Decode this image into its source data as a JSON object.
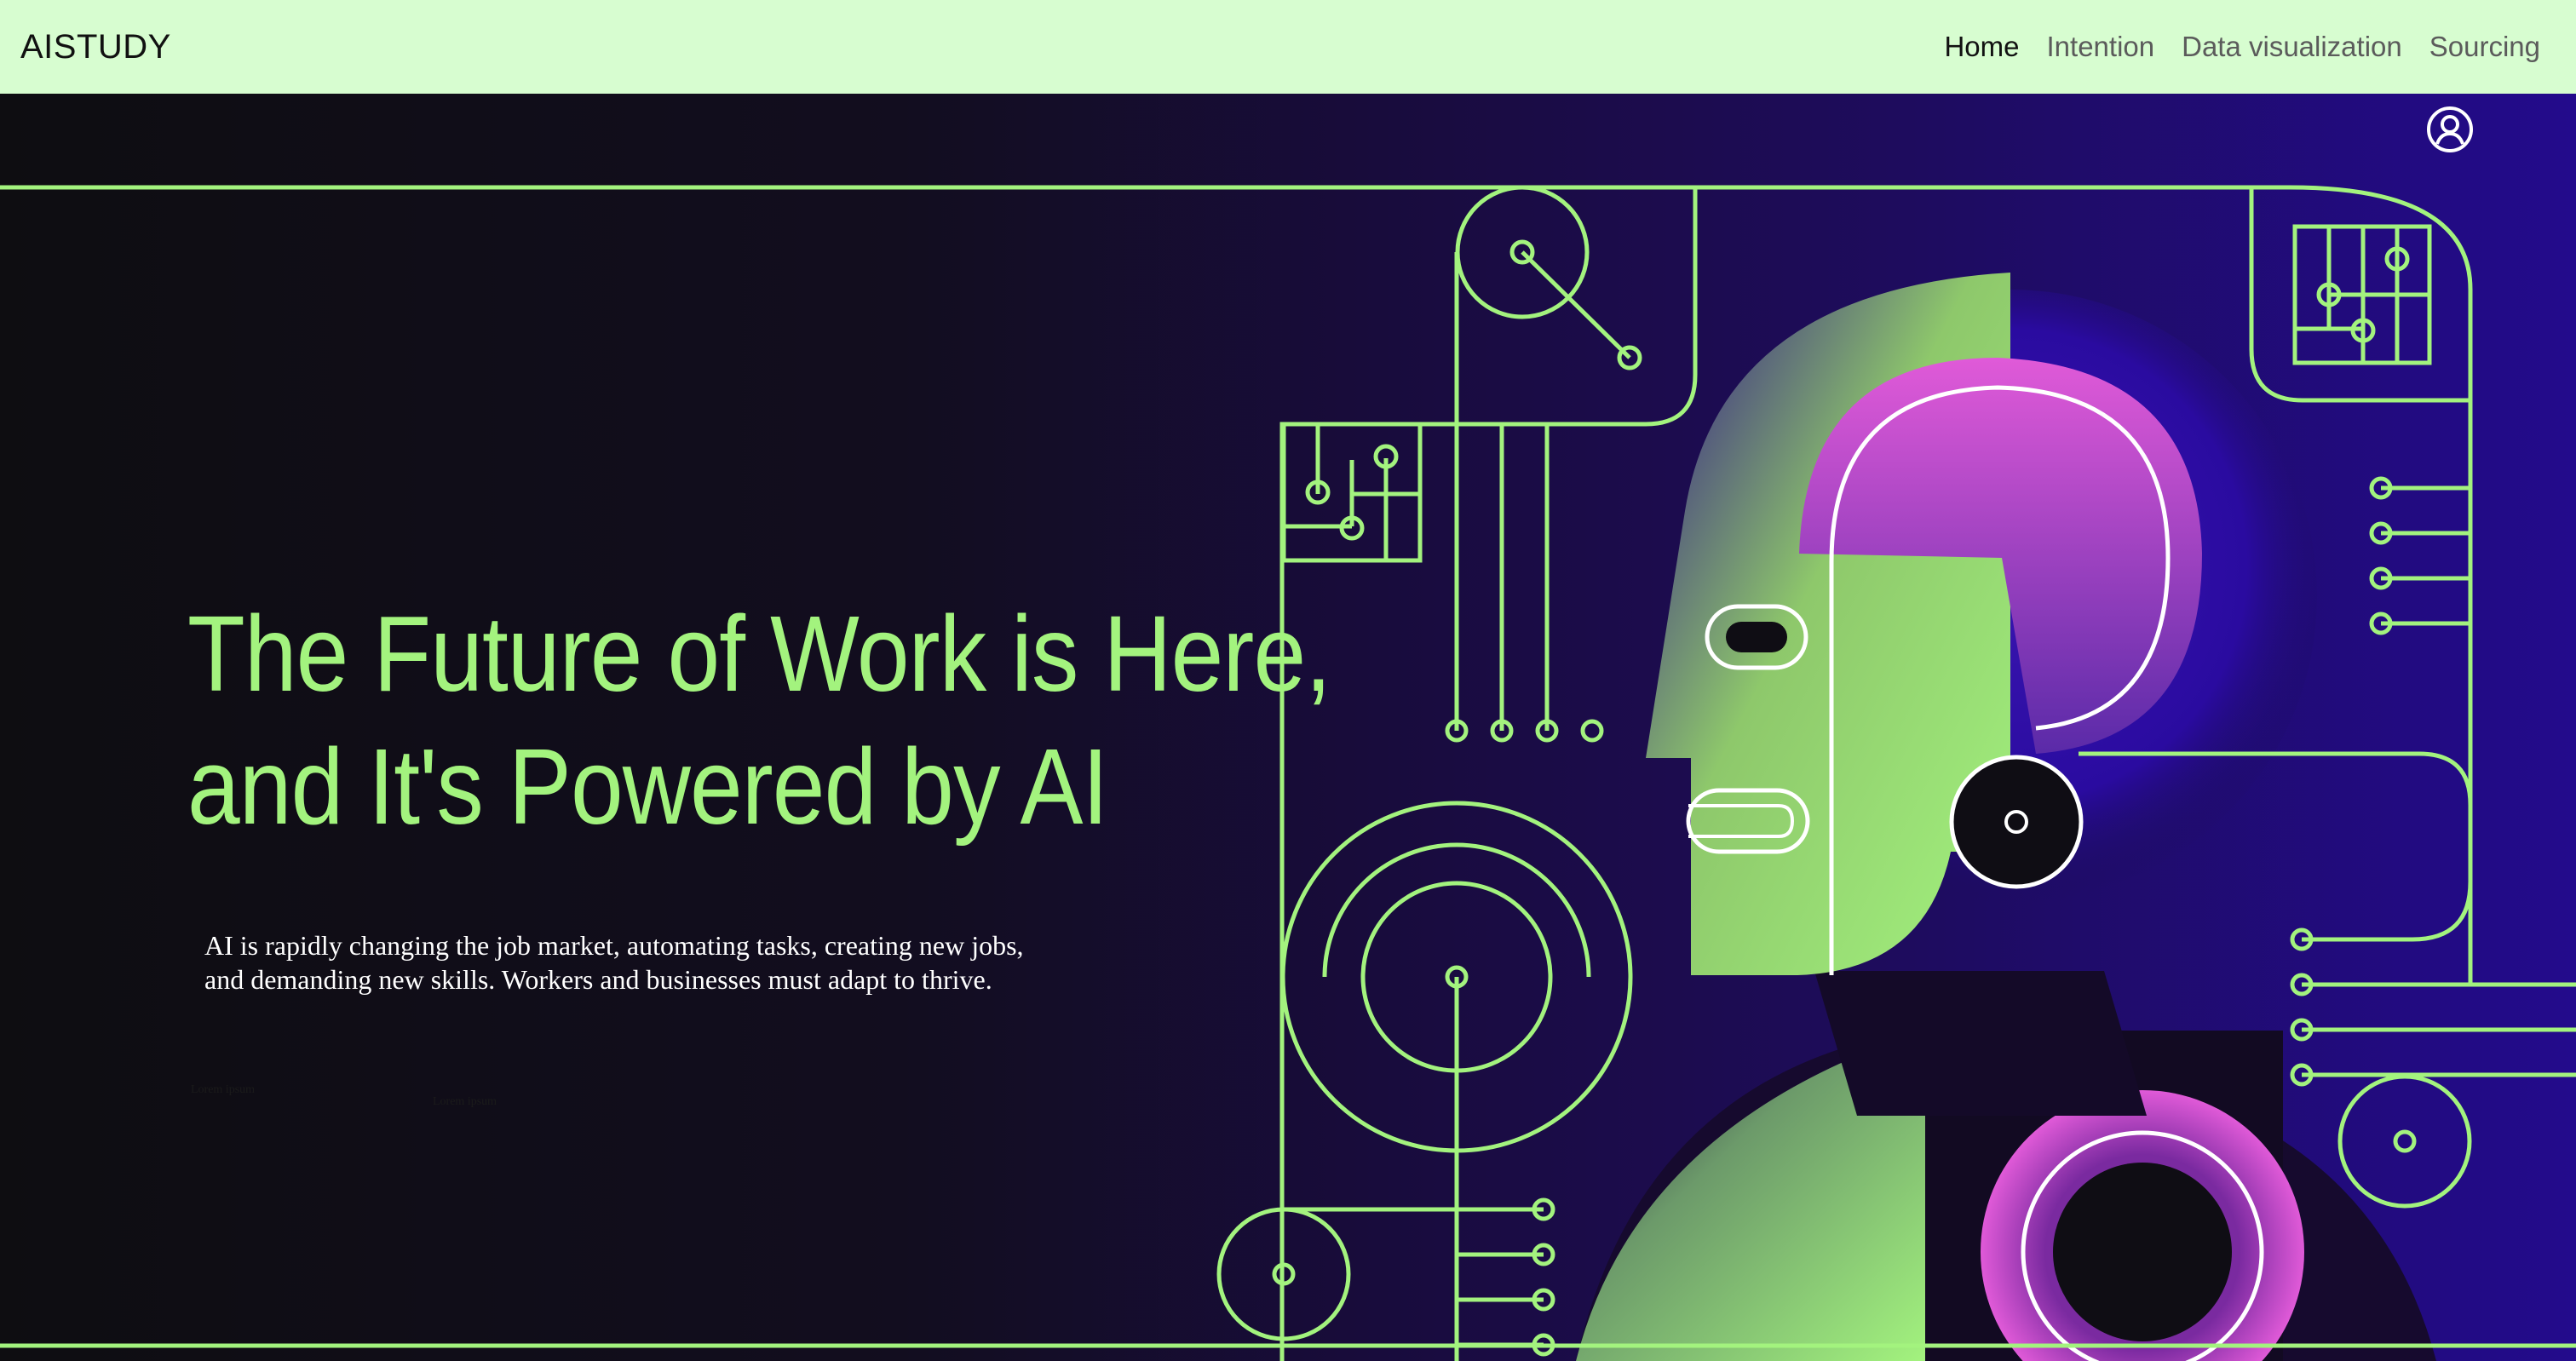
{
  "navbar": {
    "brand": "AISTUDY",
    "links": [
      {
        "label": "Home",
        "active": true
      },
      {
        "label": "Intention",
        "active": false
      },
      {
        "label": "Data visualization",
        "active": false
      },
      {
        "label": "Sourcing",
        "active": false
      }
    ],
    "background": "#d7fdd0"
  },
  "hero": {
    "headline_line1": "The Future of Work is Here,",
    "headline_line2": "and It's Powered by AI",
    "description_line1": "AI is rapidly changing the job market, automating tasks, creating new jobs,",
    "description_line2": "and demanding new skills. Workers and businesses must adapt to thrive.",
    "tiny_label_1": "Lorem ipsum",
    "tiny_label_2": "Lorem ipsum",
    "user_icon": "user-circle-icon",
    "accent_color": "#a3f37e",
    "magenta_color": "#e05ad8",
    "purple_color": "#2a07a0"
  }
}
